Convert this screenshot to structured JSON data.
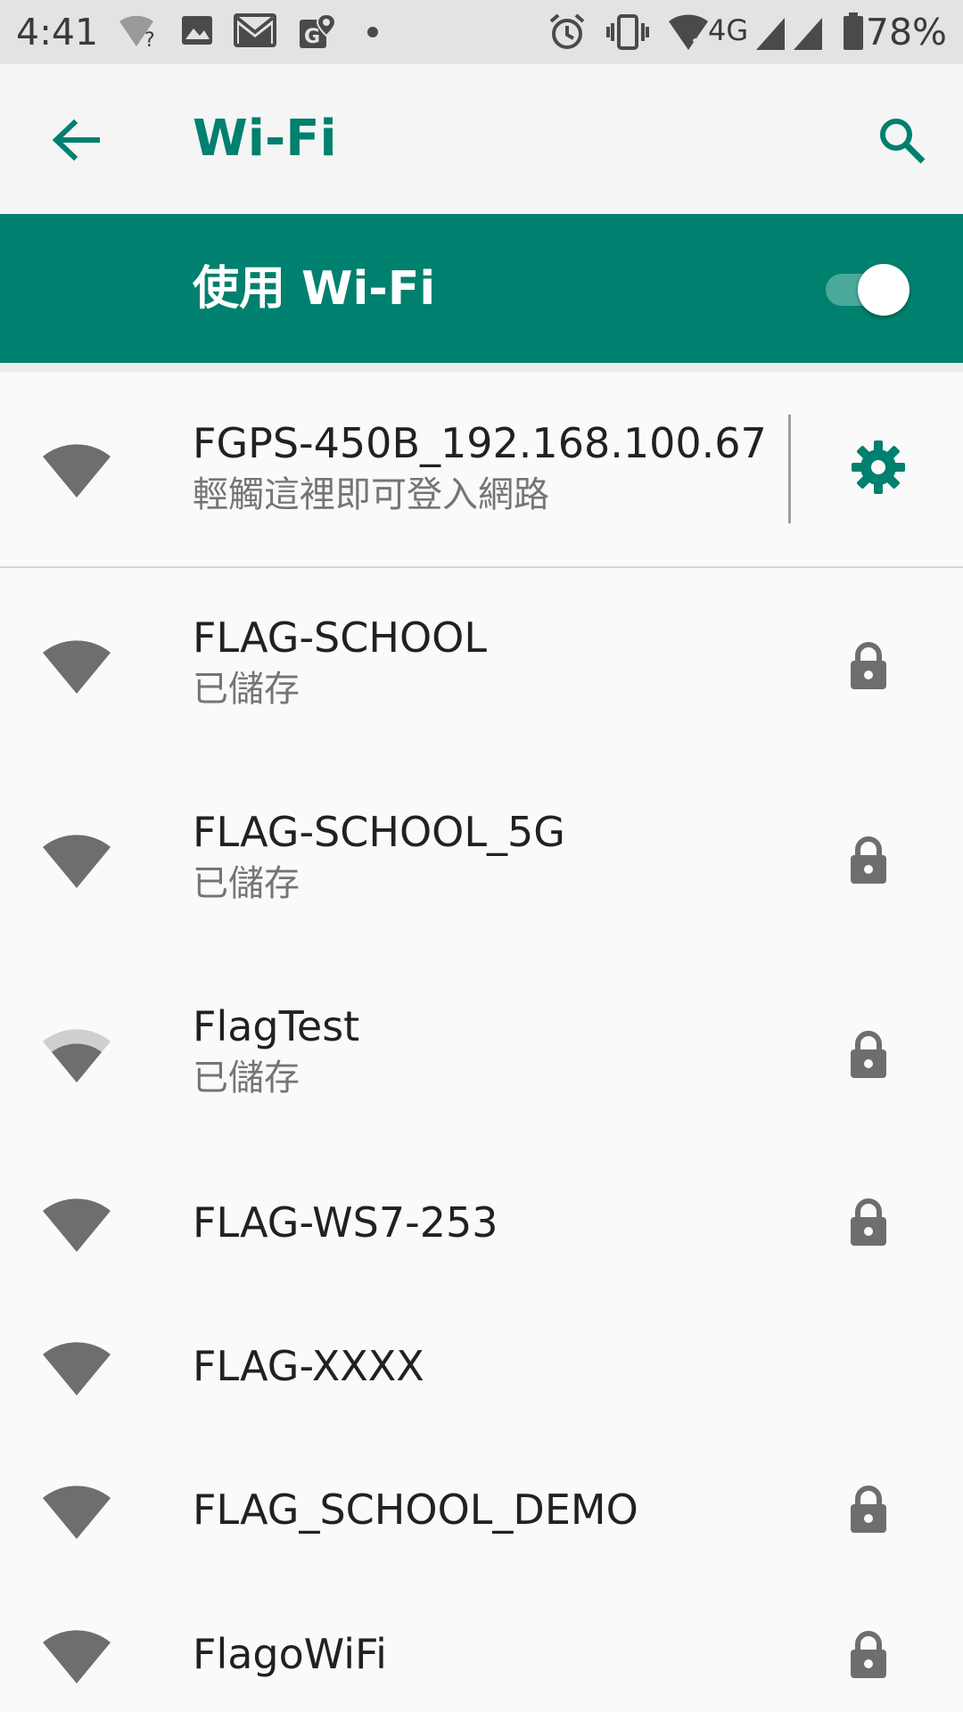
{
  "status_bar": {
    "time": "4:41",
    "battery_percent": "78%",
    "network_type": "4G",
    "unknown_wifi_glyph": "?"
  },
  "app_bar": {
    "title": "Wi-Fi"
  },
  "master_switch": {
    "label": "使用 Wi-Fi",
    "on": true
  },
  "connected_network": {
    "ssid": "FGPS-450B_192.168.100.67",
    "status": "輕觸這裡即可登入網路",
    "signal_bars": 4
  },
  "networks": [
    {
      "ssid": "FLAG-SCHOOL",
      "status": "已儲存",
      "secured": true,
      "signal_bars": 4
    },
    {
      "ssid": "FLAG-SCHOOL_5G",
      "status": "已儲存",
      "secured": true,
      "signal_bars": 4
    },
    {
      "ssid": "FlagTest",
      "status": "已儲存",
      "secured": true,
      "signal_bars": 3
    },
    {
      "ssid": "FLAG-WS7-253",
      "status": "",
      "secured": true,
      "signal_bars": 4
    },
    {
      "ssid": "FLAG-XXXX",
      "status": "",
      "secured": false,
      "signal_bars": 4
    },
    {
      "ssid": "FLAG_SCHOOL_DEMO",
      "status": "",
      "secured": true,
      "signal_bars": 4
    },
    {
      "ssid": "FlagoWiFi",
      "status": "",
      "secured": true,
      "signal_bars": 4
    }
  ],
  "colors": {
    "accent": "#00806e",
    "icon_gray": "#6e6e6e",
    "icon_light": "#cfcfcf"
  },
  "icons": {
    "back": "arrow-back-icon",
    "search": "search-icon",
    "settings": "gear-icon",
    "signal": "wifi-signal-icon",
    "lock": "lock-icon"
  }
}
